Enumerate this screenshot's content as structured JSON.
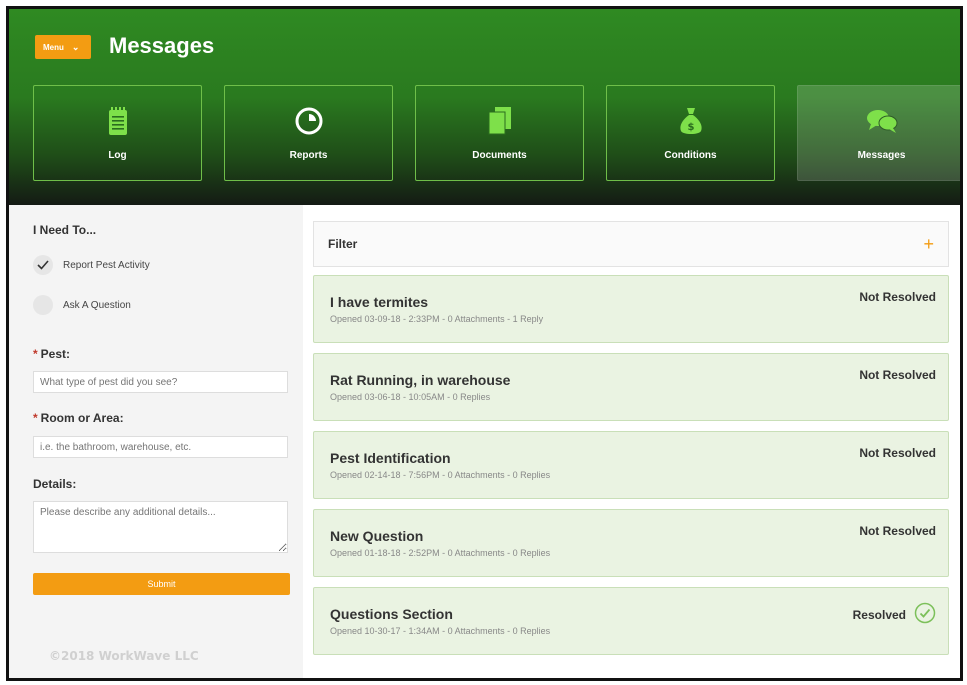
{
  "header": {
    "menu_label": "Menu",
    "title": "Messages",
    "tiles": [
      {
        "label": "Log",
        "icon": "notepad-icon"
      },
      {
        "label": "Reports",
        "icon": "pie-chart-icon"
      },
      {
        "label": "Documents",
        "icon": "documents-icon"
      },
      {
        "label": "Conditions",
        "icon": "money-bag-icon"
      },
      {
        "label": "Messages",
        "icon": "chat-bubbles-icon",
        "active": true
      }
    ]
  },
  "form": {
    "heading": "I Need To...",
    "options": [
      {
        "label": "Report Pest Activity",
        "checked": true
      },
      {
        "label": "Ask A Question",
        "checked": false
      }
    ],
    "pest_label": "Pest:",
    "pest_placeholder": "What type of pest did you see?",
    "room_label": "Room or Area:",
    "room_placeholder": "i.e. the bathroom, warehouse, etc.",
    "details_label": "Details:",
    "details_placeholder": "Please describe any additional details...",
    "submit_label": "Submit"
  },
  "copyright": "©2018 WorkWave LLC",
  "filter": {
    "label": "Filter",
    "plus": "+"
  },
  "messages": [
    {
      "title": "I have termites",
      "meta": "Opened 03-09-18 - 2:33PM - 0 Attachments - 1 Reply",
      "status": "Not Resolved"
    },
    {
      "title": "Rat Running, in warehouse",
      "meta": "Opened 03-06-18 - 10:05AM - 0 Replies",
      "status": "Not Resolved"
    },
    {
      "title": "Pest Identification",
      "meta": "Opened 02-14-18 - 7:56PM - 0 Attachments - 0 Replies",
      "status": "Not Resolved"
    },
    {
      "title": "New Question",
      "meta": "Opened 01-18-18 - 2:52PM - 0 Attachments - 0 Replies",
      "status": "Not Resolved"
    },
    {
      "title": "Questions Section",
      "meta": "Opened 10-30-17 - 1:34AM - 0 Attachments - 0 Replies",
      "status": "Resolved"
    }
  ],
  "colors": {
    "accent": "#f39c12",
    "brand_green": "#2f8a22",
    "resolved_check": "#7cc05a"
  }
}
